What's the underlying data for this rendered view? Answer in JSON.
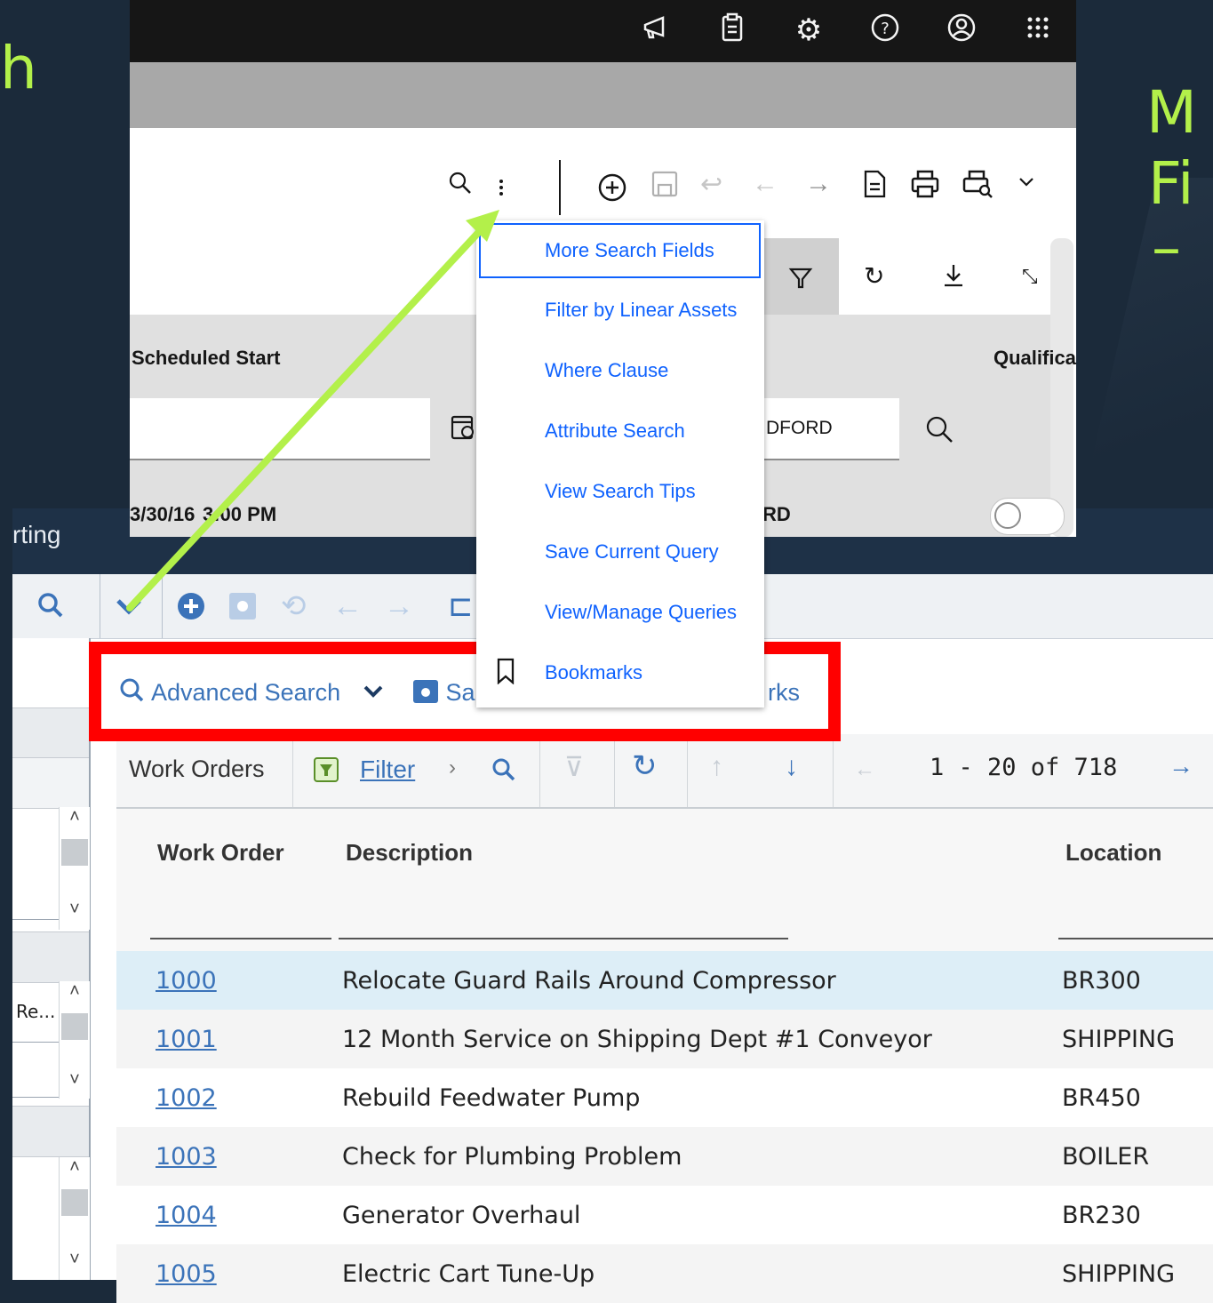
{
  "slide": {
    "left_text": "h",
    "right_text_line1": "M",
    "right_text_line2": "Fi",
    "right_text_line3": "–",
    "accent_color": "#b3f04a",
    "highlight_color": "#ff0000"
  },
  "old_app": {
    "title_partial": "rting",
    "left_panel_cell": "Re...",
    "advanced_bar": {
      "advanced_search": "Advanced Search",
      "save_partial": "Sa",
      "bookmarks_partial": "rks"
    },
    "work_orders_bar": {
      "title": "Work Orders",
      "filter": "Filter",
      "pager_text": "1 -  20 of 718"
    },
    "table": {
      "headers": [
        "Work Order",
        "Description",
        "Location"
      ],
      "rows": [
        {
          "wo": "1000",
          "desc": "Relocate Guard Rails Around Compressor",
          "loc": "BR300"
        },
        {
          "wo": "1001",
          "desc": "12 Month Service on Shipping Dept #1 Conveyor",
          "loc": "SHIPPING"
        },
        {
          "wo": "1002",
          "desc": "Rebuild Feedwater Pump",
          "loc": "BR450"
        },
        {
          "wo": "1003",
          "desc": "Check for Plumbing Problem",
          "loc": "BOILER"
        },
        {
          "wo": "1004",
          "desc": "Generator Overhaul",
          "loc": "BR230"
        },
        {
          "wo": "1005",
          "desc": "Electric Cart Tune-Up",
          "loc": "SHIPPING"
        }
      ]
    }
  },
  "new_app": {
    "topbar_icons": [
      "megaphone-icon",
      "clipboard-icon",
      "gear-icon",
      "help-icon",
      "user-icon",
      "app-switcher-icon"
    ],
    "columns": {
      "scheduled_start": "Scheduled Start",
      "qualifications_partial": "Qualifica"
    },
    "filter_value_partial": "DFORD",
    "data_row": {
      "date_partial_a": "3/30/16",
      "date_partial_b": "3:00 PM",
      "value_partial": "RD"
    },
    "menu": [
      "More Search Fields",
      "Filter by Linear Assets",
      "Where Clause",
      "Attribute Search",
      "View Search Tips",
      "Save Current Query",
      "View/Manage Queries",
      "Bookmarks"
    ]
  }
}
